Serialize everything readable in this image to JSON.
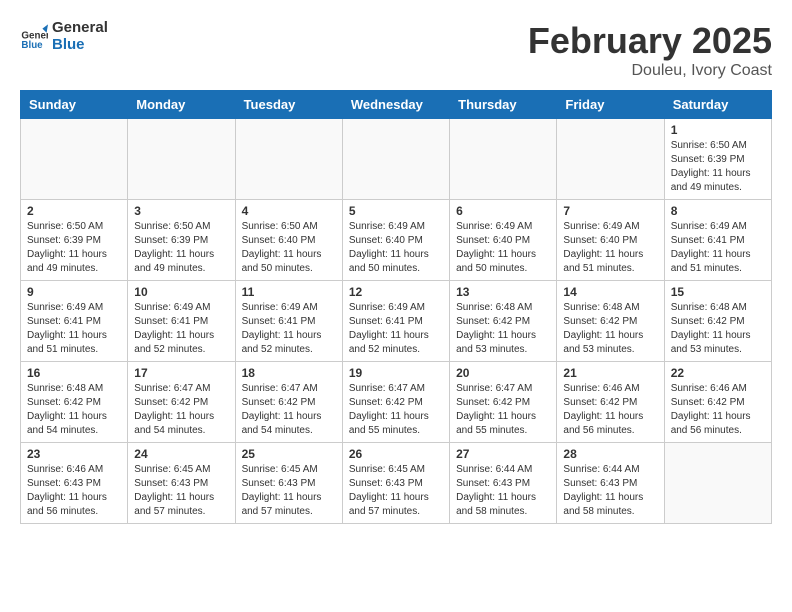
{
  "header": {
    "logo_general": "General",
    "logo_blue": "Blue",
    "month_title": "February 2025",
    "location": "Douleu, Ivory Coast"
  },
  "weekdays": [
    "Sunday",
    "Monday",
    "Tuesday",
    "Wednesday",
    "Thursday",
    "Friday",
    "Saturday"
  ],
  "weeks": [
    [
      {
        "day": "",
        "info": ""
      },
      {
        "day": "",
        "info": ""
      },
      {
        "day": "",
        "info": ""
      },
      {
        "day": "",
        "info": ""
      },
      {
        "day": "",
        "info": ""
      },
      {
        "day": "",
        "info": ""
      },
      {
        "day": "1",
        "info": "Sunrise: 6:50 AM\nSunset: 6:39 PM\nDaylight: 11 hours and 49 minutes."
      }
    ],
    [
      {
        "day": "2",
        "info": "Sunrise: 6:50 AM\nSunset: 6:39 PM\nDaylight: 11 hours and 49 minutes."
      },
      {
        "day": "3",
        "info": "Sunrise: 6:50 AM\nSunset: 6:39 PM\nDaylight: 11 hours and 49 minutes."
      },
      {
        "day": "4",
        "info": "Sunrise: 6:50 AM\nSunset: 6:40 PM\nDaylight: 11 hours and 50 minutes."
      },
      {
        "day": "5",
        "info": "Sunrise: 6:49 AM\nSunset: 6:40 PM\nDaylight: 11 hours and 50 minutes."
      },
      {
        "day": "6",
        "info": "Sunrise: 6:49 AM\nSunset: 6:40 PM\nDaylight: 11 hours and 50 minutes."
      },
      {
        "day": "7",
        "info": "Sunrise: 6:49 AM\nSunset: 6:40 PM\nDaylight: 11 hours and 51 minutes."
      },
      {
        "day": "8",
        "info": "Sunrise: 6:49 AM\nSunset: 6:41 PM\nDaylight: 11 hours and 51 minutes."
      }
    ],
    [
      {
        "day": "9",
        "info": "Sunrise: 6:49 AM\nSunset: 6:41 PM\nDaylight: 11 hours and 51 minutes."
      },
      {
        "day": "10",
        "info": "Sunrise: 6:49 AM\nSunset: 6:41 PM\nDaylight: 11 hours and 52 minutes."
      },
      {
        "day": "11",
        "info": "Sunrise: 6:49 AM\nSunset: 6:41 PM\nDaylight: 11 hours and 52 minutes."
      },
      {
        "day": "12",
        "info": "Sunrise: 6:49 AM\nSunset: 6:41 PM\nDaylight: 11 hours and 52 minutes."
      },
      {
        "day": "13",
        "info": "Sunrise: 6:48 AM\nSunset: 6:42 PM\nDaylight: 11 hours and 53 minutes."
      },
      {
        "day": "14",
        "info": "Sunrise: 6:48 AM\nSunset: 6:42 PM\nDaylight: 11 hours and 53 minutes."
      },
      {
        "day": "15",
        "info": "Sunrise: 6:48 AM\nSunset: 6:42 PM\nDaylight: 11 hours and 53 minutes."
      }
    ],
    [
      {
        "day": "16",
        "info": "Sunrise: 6:48 AM\nSunset: 6:42 PM\nDaylight: 11 hours and 54 minutes."
      },
      {
        "day": "17",
        "info": "Sunrise: 6:47 AM\nSunset: 6:42 PM\nDaylight: 11 hours and 54 minutes."
      },
      {
        "day": "18",
        "info": "Sunrise: 6:47 AM\nSunset: 6:42 PM\nDaylight: 11 hours and 54 minutes."
      },
      {
        "day": "19",
        "info": "Sunrise: 6:47 AM\nSunset: 6:42 PM\nDaylight: 11 hours and 55 minutes."
      },
      {
        "day": "20",
        "info": "Sunrise: 6:47 AM\nSunset: 6:42 PM\nDaylight: 11 hours and 55 minutes."
      },
      {
        "day": "21",
        "info": "Sunrise: 6:46 AM\nSunset: 6:42 PM\nDaylight: 11 hours and 56 minutes."
      },
      {
        "day": "22",
        "info": "Sunrise: 6:46 AM\nSunset: 6:42 PM\nDaylight: 11 hours and 56 minutes."
      }
    ],
    [
      {
        "day": "23",
        "info": "Sunrise: 6:46 AM\nSunset: 6:43 PM\nDaylight: 11 hours and 56 minutes."
      },
      {
        "day": "24",
        "info": "Sunrise: 6:45 AM\nSunset: 6:43 PM\nDaylight: 11 hours and 57 minutes."
      },
      {
        "day": "25",
        "info": "Sunrise: 6:45 AM\nSunset: 6:43 PM\nDaylight: 11 hours and 57 minutes."
      },
      {
        "day": "26",
        "info": "Sunrise: 6:45 AM\nSunset: 6:43 PM\nDaylight: 11 hours and 57 minutes."
      },
      {
        "day": "27",
        "info": "Sunrise: 6:44 AM\nSunset: 6:43 PM\nDaylight: 11 hours and 58 minutes."
      },
      {
        "day": "28",
        "info": "Sunrise: 6:44 AM\nSunset: 6:43 PM\nDaylight: 11 hours and 58 minutes."
      },
      {
        "day": "",
        "info": ""
      }
    ]
  ]
}
